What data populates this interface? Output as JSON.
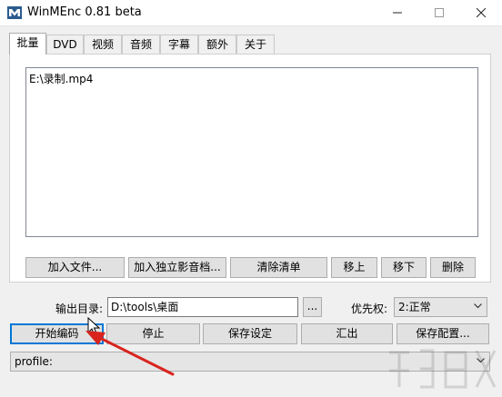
{
  "window": {
    "title": "WinMEnc 0.81 beta",
    "icon": "winmenc-logo-icon",
    "controls": [
      "minimize-icon",
      "maximize-icon",
      "close-icon"
    ]
  },
  "tabs": [
    {
      "label": "批量",
      "active": true
    },
    {
      "label": "DVD",
      "active": false
    },
    {
      "label": "视频",
      "active": false
    },
    {
      "label": "音频",
      "active": false
    },
    {
      "label": "字幕",
      "active": false
    },
    {
      "label": "额外",
      "active": false
    },
    {
      "label": "关于",
      "active": false
    }
  ],
  "batch": {
    "files": [
      "E:\\录制.mp4"
    ],
    "buttons": {
      "add_file": "加入文件...",
      "add_audio": "加入独立影音档...",
      "clear": "清除清单",
      "move_up": "移上",
      "move_down": "移下",
      "delete": "删除"
    }
  },
  "output": {
    "label": "输出目录:",
    "value": "D:\\tools\\桌面",
    "browse": "..."
  },
  "priority": {
    "label": "优先权:",
    "value": "2:正常"
  },
  "actions": {
    "start": "开始编码",
    "stop": "停止",
    "save_settings": "保存设定",
    "export": "汇出",
    "save_config": "保存配置..."
  },
  "profile": {
    "value": "profile:"
  },
  "colors": {
    "annotation_arrow": "#d9231d",
    "focus_border": "#0078d7"
  }
}
